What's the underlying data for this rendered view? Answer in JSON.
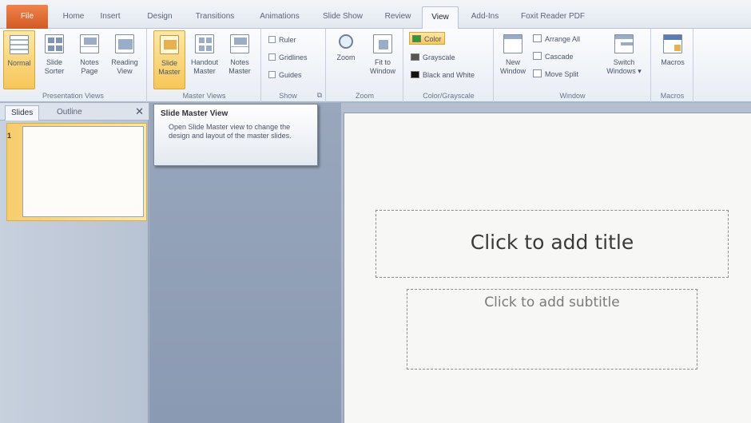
{
  "tabs": [
    "File",
    "Home",
    "Insert",
    "Design",
    "Transitions",
    "Animations",
    "Slide Show",
    "Review",
    "View",
    "Add-Ins",
    "Foxit Reader PDF"
  ],
  "active_tab": "View",
  "ribbon": {
    "presentation_views": {
      "label": "Presentation Views",
      "buttons": [
        {
          "line1": "Normal",
          "line2": ""
        },
        {
          "line1": "Slide",
          "line2": "Sorter"
        },
        {
          "line1": "Notes",
          "line2": "Page"
        },
        {
          "line1": "Reading",
          "line2": "View"
        }
      ]
    },
    "master_views": {
      "label": "Master Views",
      "buttons": [
        {
          "line1": "Slide",
          "line2": "Master"
        },
        {
          "line1": "Handout",
          "line2": "Master"
        },
        {
          "line1": "Notes",
          "line2": "Master"
        }
      ]
    },
    "show": {
      "label": "Show",
      "items": [
        "Ruler",
        "Gridlines",
        "Guides"
      ]
    },
    "zoom": {
      "label": "Zoom",
      "zoom_btn": "Zoom",
      "fit_line1": "Fit to",
      "fit_line2": "Window"
    },
    "color": {
      "label": "Color/Grayscale",
      "items": [
        {
          "label": "Color",
          "swatch": "#2e9b2e"
        },
        {
          "label": "Grayscale",
          "swatch": "#555555"
        },
        {
          "label": "Black and White",
          "swatch": "#111111"
        }
      ]
    },
    "window": {
      "label": "Window",
      "new_line1": "New",
      "new_line2": "Window",
      "items": [
        "Arrange All",
        "Cascade",
        "Move Split"
      ],
      "switch_line1": "Switch",
      "switch_line2": "Windows ▾"
    },
    "macros": {
      "label": "Macros",
      "button": "Macros"
    }
  },
  "left_pane": {
    "tabs": [
      "Slides",
      "Outline"
    ],
    "close": "✕",
    "slide_number": "1"
  },
  "tooltip": {
    "title": "Slide Master View",
    "body": "Open Slide Master view to change the design and layout of the master slides."
  },
  "slide": {
    "title_placeholder": "Click to add title",
    "subtitle_placeholder": "Click to add subtitle"
  }
}
